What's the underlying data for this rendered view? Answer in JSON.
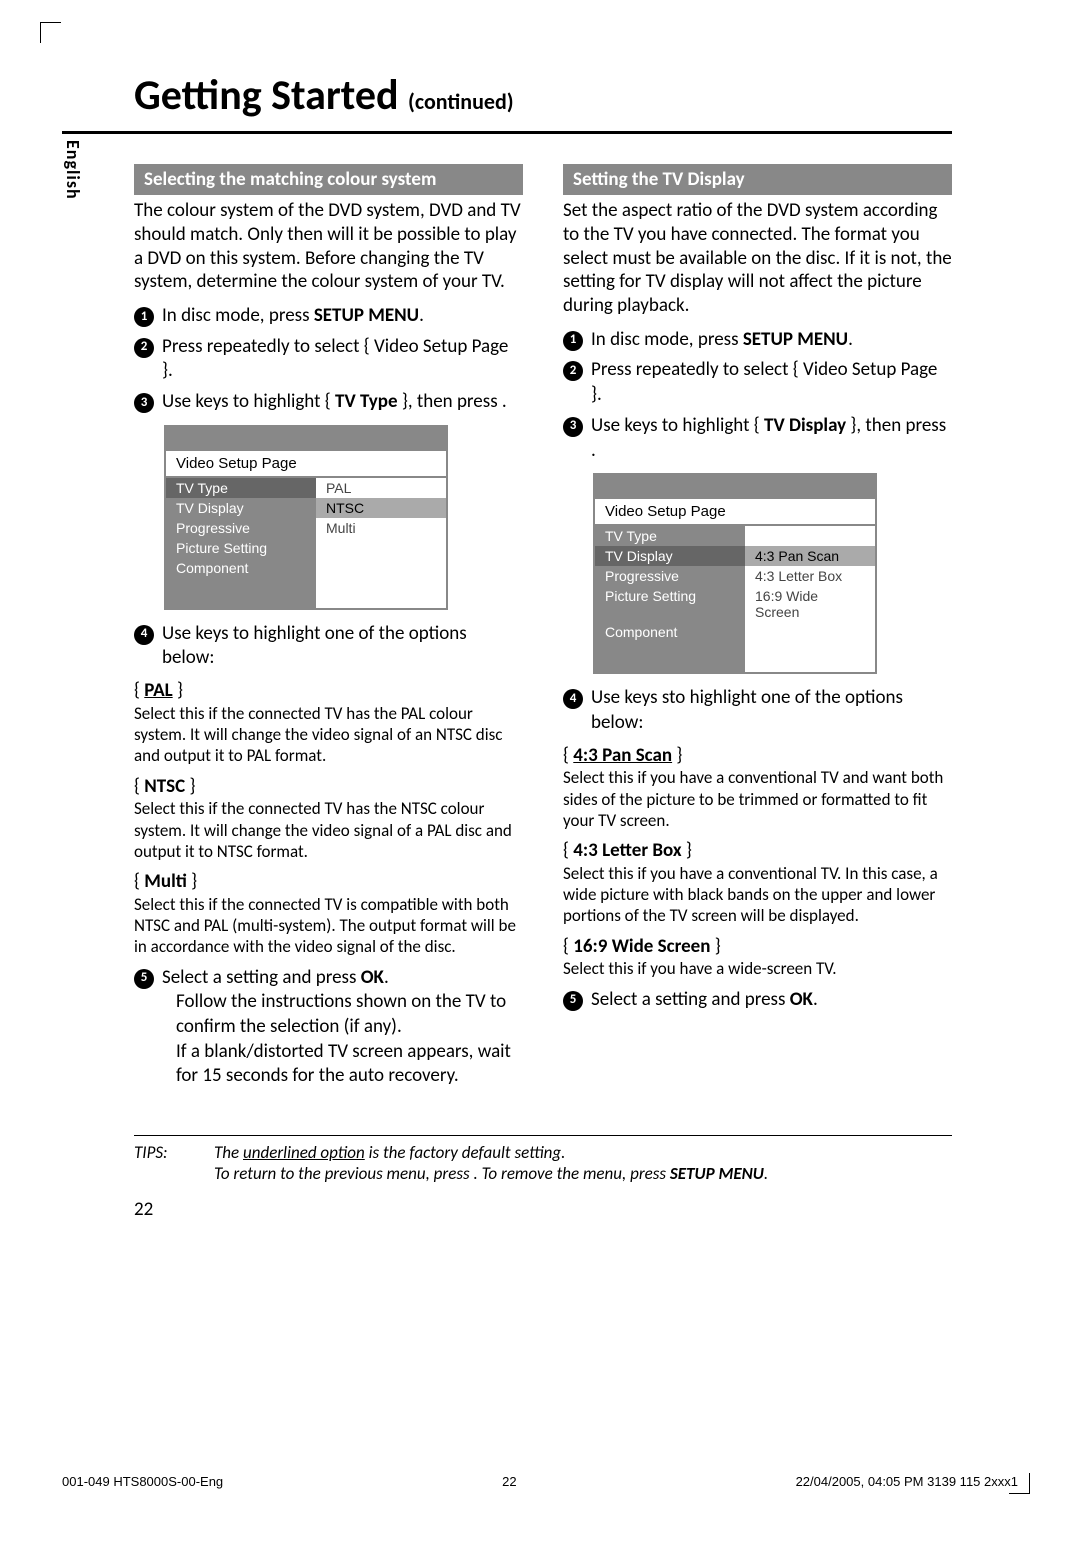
{
  "lang_tab": "English",
  "title_main": "Getting Started",
  "title_cont": "(continued)",
  "left": {
    "header": "Selecting the matching colour system",
    "intro": "The colour system of the DVD system, DVD and TV should match. Only then will it be possible to play a DVD on this system.  Before changing the TV system, determine the colour system of your TV.",
    "step1_a": "In disc mode, press ",
    "step1_b": "SETUP MENU",
    "step1_c": ".",
    "step2": "Press      repeatedly to select { Video Setup Page }.",
    "step3_a": "Use       keys to highlight { ",
    "step3_b": "TV Type",
    "step3_c": " }, then press   .",
    "menu": {
      "title": "Video Setup Page",
      "items": [
        "TV Type",
        "TV Display",
        "Progressive",
        "Picture Setting",
        "Component"
      ],
      "selected": 0,
      "options": [
        "PAL",
        "NTSC",
        "Multi"
      ],
      "opt_selected": 1
    },
    "step4": "Use        keys to highlight one of the options below:",
    "opts": [
      {
        "label": "PAL",
        "underline": true,
        "desc": "Select this if the connected TV has the PAL colour system. It will change the video signal of an NTSC disc and output it to PAL format."
      },
      {
        "label": "NTSC",
        "underline": false,
        "desc": "Select this if the connected TV has the NTSC colour system. It will change the video signal of a PAL disc and output it to NTSC format."
      },
      {
        "label": "Multi",
        "underline": false,
        "desc": "Select this if the connected TV is compatible with both NTSC and PAL (multi-system). The output format will be in accordance with the video signal of the disc."
      }
    ],
    "step5_a": "Select a setting and press ",
    "step5_b": "OK",
    "step5_c": ".",
    "step5_follow1": "Follow the instructions shown on the TV to confirm the selection (if any).",
    "step5_follow2": "If a blank/distorted TV screen appears, wait for 15 seconds for the auto recovery."
  },
  "right": {
    "header": "Setting the TV Display",
    "intro": "Set the aspect ratio of the DVD system according to the TV you have connected. The format you select must be available on the disc.  If it is not, the setting for TV display will not affect the picture during playback.",
    "step1_a": "In disc mode, press ",
    "step1_b": "SETUP MENU",
    "step1_c": ".",
    "step2": "Press      repeatedly to select { Video Setup Page }.",
    "step3_a": "Use       keys to highlight { ",
    "step3_b": "TV Display",
    "step3_c": " }, then press   .",
    "menu": {
      "title": "Video Setup Page",
      "items": [
        "TV Type",
        "TV Display",
        "Progressive",
        "Picture Setting",
        "Component"
      ],
      "selected": 1,
      "options": [
        "4:3 Pan Scan",
        "4:3 Letter Box",
        "16:9 Wide Screen"
      ],
      "opt_selected": 0
    },
    "step4": "Use        keys sto highlight one of the options below:",
    "opts": [
      {
        "label": "4:3 Pan Scan",
        "underline": true,
        "desc": "Select this if you have a conventional TV and want both sides of the picture to be trimmed or formatted to fit your TV screen."
      },
      {
        "label": "4:3 Letter Box",
        "underline": false,
        "desc": "Select this if you have a conventional TV.  In this case, a wide picture with black bands on the upper and lower portions of the TV screen will be displayed."
      },
      {
        "label": "16:9 Wide Screen",
        "underline": false,
        "desc": "Select this if you have a wide-screen TV."
      }
    ],
    "step5_a": "Select a setting and press ",
    "step5_b": "OK",
    "step5_c": "."
  },
  "tips": {
    "label": "TIPS:",
    "line1_a": "The ",
    "line1_u": "underlined option",
    "line1_b": " is the factory default setting.",
    "line2_a": "To return to the previous menu, press   .  To remove the menu, press ",
    "line2_b": "SETUP MENU",
    "line2_c": "."
  },
  "page_number": "22",
  "footer": {
    "left": "001-049 HTS8000S-00-Eng",
    "center": "22",
    "right_a": "22/04/2005, 04:05 PM",
    "right_b": "3139 115 2xxx1"
  }
}
